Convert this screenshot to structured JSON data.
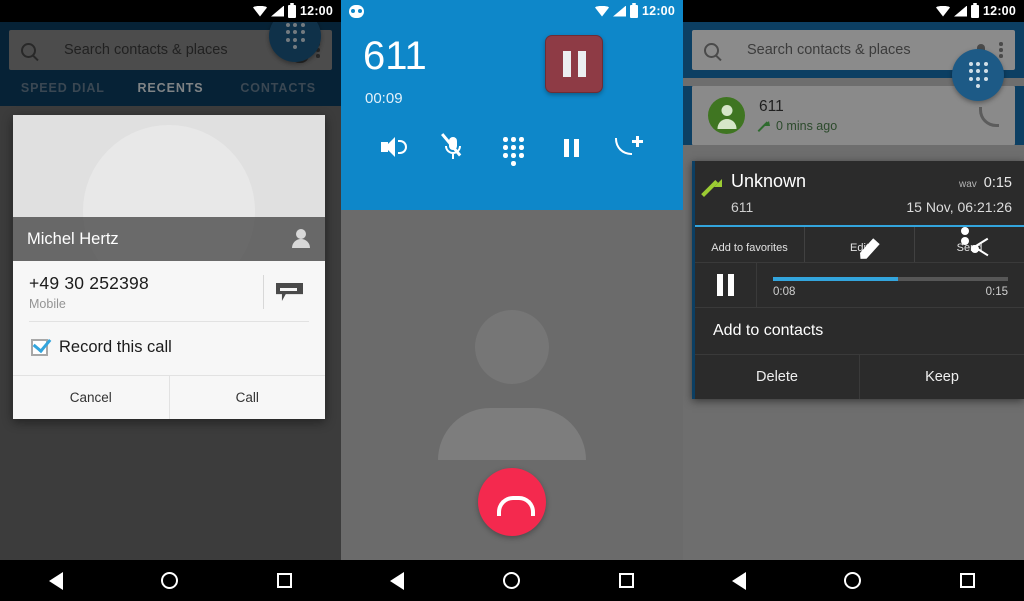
{
  "status_bar": {
    "time": "12:00",
    "icons": [
      "wifi-icon",
      "signal-icon",
      "battery-icon"
    ],
    "voicemail_icon": "voicemail-icon"
  },
  "panel1": {
    "search": {
      "placeholder": "Search contacts & places",
      "search_icon": "search-icon",
      "mic_icon": "microphone-icon",
      "overflow_icon": "overflow-menu-icon"
    },
    "tabs": [
      {
        "label": "SPEED DIAL",
        "active": false
      },
      {
        "label": "RECENTS",
        "active": true
      },
      {
        "label": "CONTACTS",
        "active": false
      }
    ],
    "dialog": {
      "contact_name": "Michel Hertz",
      "person_icon": "person-icon",
      "phone_number": "+49 30 252398",
      "phone_type": "Mobile",
      "sms_icon": "sms-icon",
      "record_checkbox_label": "Record this call",
      "record_checked": true,
      "cancel_label": "Cancel",
      "call_label": "Call"
    },
    "fab": {
      "icon": "dialpad-icon"
    }
  },
  "panel2": {
    "call": {
      "number": "611",
      "duration": "00:09",
      "record_pause_icon": "recording-pause-icon",
      "actions": [
        {
          "name": "speaker-icon",
          "label": "Speaker"
        },
        {
          "name": "mute-icon",
          "label": "Mute"
        },
        {
          "name": "dialpad-icon",
          "label": "Dialpad"
        },
        {
          "name": "hold-icon",
          "label": "Hold"
        },
        {
          "name": "add-call-icon",
          "label": "Add call"
        }
      ],
      "end_call_icon": "end-call-icon",
      "avatar_placeholder": "avatar-placeholder"
    }
  },
  "panel3": {
    "search": {
      "placeholder": "Search contacts & places",
      "search_icon": "search-icon",
      "mic_icon": "microphone-icon",
      "overflow_icon": "overflow-menu-icon"
    },
    "recent_entry": {
      "name": "611",
      "meta": "0 mins ago",
      "direction_icon": "outgoing-call-arrow-icon",
      "call_icon": "phone-call-icon",
      "avatar_icon": "contact-avatar-icon"
    },
    "recording_card": {
      "title": "Unknown",
      "subtitle": "611",
      "format": "wav",
      "duration": "0:15",
      "timestamp": "15 Nov, 06:21:26",
      "direction_icon": "outgoing-call-arrow-icon",
      "actions": [
        {
          "icon": "star-icon",
          "label": "Add to favorites"
        },
        {
          "icon": "pencil-icon",
          "label": "Edit"
        },
        {
          "icon": "share-icon",
          "label": "Send"
        }
      ],
      "player": {
        "pause_icon": "pause-icon",
        "elapsed": "0:08",
        "total": "0:15",
        "progress_percent": 53
      },
      "add_to_contacts_label": "Add to contacts",
      "delete_label": "Delete",
      "keep_label": "Keep"
    },
    "fab": {
      "icon": "dialpad-icon"
    }
  },
  "nav_bar": {
    "back_icon": "back-triangle-icon",
    "home_icon": "home-circle-icon",
    "recents_icon": "recents-square-icon"
  },
  "colors": {
    "accent_blue": "#0e87c9",
    "header_navy": "#0c3f63",
    "record_red": "#8e3b45",
    "end_call_red": "#f4294e",
    "progress_blue": "#33a5dd",
    "arrow_green": "#9ccc33",
    "avatar_green": "#3f7521",
    "card_dark": "#2b2b2b"
  }
}
